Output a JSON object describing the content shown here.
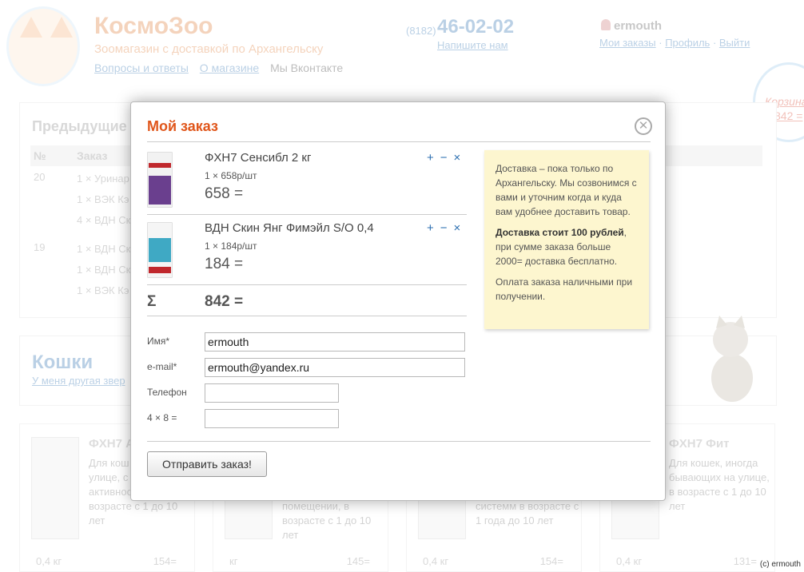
{
  "header": {
    "brand": "КосмоЗоо",
    "tagline": "Зоомагазин с доставкой по Архангельску",
    "nav": [
      "Вопросы и ответы",
      "О магазине",
      "Мы Вконтакте"
    ],
    "phone_code": "(8182)",
    "phone_number": "46-02-02",
    "write_us": "Напишите нам",
    "user_name": "ermouth",
    "user_links": [
      "Мои заказы",
      "Профиль",
      "Выйти"
    ],
    "cart_label": "Корзина",
    "cart_sum": "842 ="
  },
  "previous_orders": {
    "title": "Предыдущие",
    "col_num": "№",
    "col_order": "Заказ",
    "orders": [
      {
        "num": "20",
        "lines": [
          "1 × Уринар",
          "1 × ВЭК Кэ",
          "4 × ВДН Ск"
        ]
      },
      {
        "num": "19",
        "lines": [
          "1 × ВДН Ск",
          "1 × ВДН Ск",
          "1 × ВЭК Кэ"
        ]
      }
    ]
  },
  "category": {
    "title": "Кошки",
    "link": "У меня другая звер"
  },
  "products": [
    {
      "name": "ФХН7 А",
      "desc": "Для кош бывающ улице, с активностью, в возрасте с 1 до 10 лет",
      "weight": "0,4 кг",
      "price": "154="
    },
    {
      "name": "",
      "desc": "помещении, в возрасте с 1 до 10 лет",
      "weight": "кг",
      "price": "145="
    },
    {
      "name": "",
      "desc": "системм в возрасте с 1 года до 10 лет",
      "weight": "0,4 кг",
      "price": "154="
    },
    {
      "name": "ФХН7 Фит",
      "desc": "Для кошек, иногда бывающих на улице, в возрасте с 1 до 10 лет",
      "weight": "0,4 кг",
      "price": "131="
    }
  ],
  "copyright": "(c) ermouth",
  "modal": {
    "title": "Мой заказ",
    "close_icon": "close-icon",
    "items": [
      {
        "name": "ФХН7 Сенсибл 2 кг",
        "qty": "1 × 658р/шт",
        "sum": "658 =",
        "plus": "+",
        "minus": "−",
        "remove": "×",
        "color": "#6a3f8e"
      },
      {
        "name": "ВДН Скин Янг Фимэйл S/O 0,4",
        "qty": "1 × 184р/шт",
        "sum": "184 =",
        "plus": "+",
        "minus": "−",
        "remove": "×",
        "color": "#3fa9c4"
      }
    ],
    "sigma": "Σ",
    "total": "842 =",
    "form": {
      "name_label": "Имя*",
      "name_value": "ermouth",
      "email_label": "e-mail*",
      "email_value": "ermouth@yandex.ru",
      "phone_label": "Телефон",
      "phone_value": "",
      "captcha_label": "4 × 8 =",
      "captcha_value": ""
    },
    "submit_label": "Отправить заказ!",
    "note": {
      "p1": "Доставка – пока только по Архангельску. Мы созвонимся с вами и уточним когда и куда вам удобнее доставить товар.",
      "p2_bold": "Доставка стоит 100 рублей",
      "p2_rest": ", при сумме заказа больше 2000= доставка бесплатно.",
      "p3": "Оплата заказа наличными при получении."
    }
  },
  "colors": {
    "accent": "#e0561b",
    "link": "#2c6fb0",
    "note_bg": "#fdf6cf"
  }
}
